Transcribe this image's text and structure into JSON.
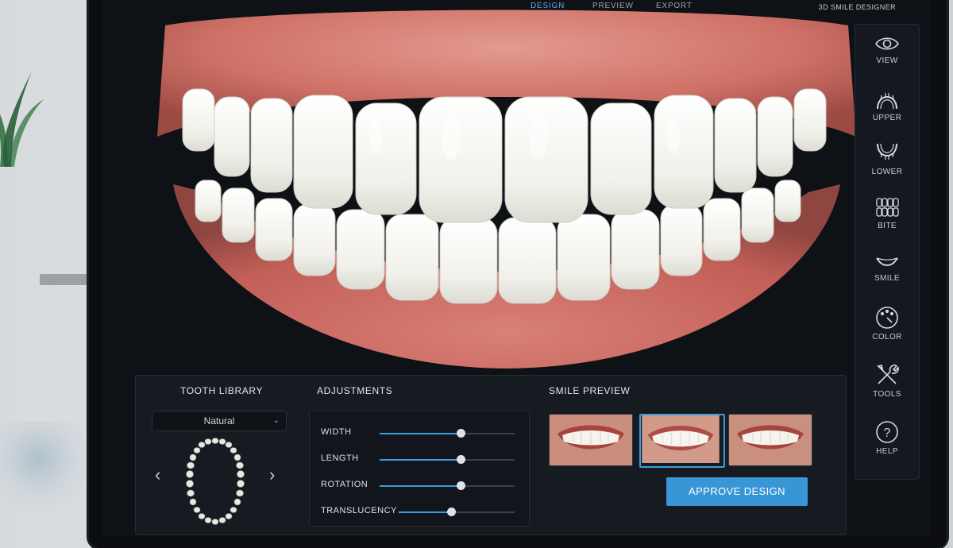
{
  "nav": {
    "items": [
      "DESIGN",
      "PREVIEW",
      "EXPORT"
    ],
    "active": "DESIGN",
    "brand": "3D SMILE DESIGNER"
  },
  "toolbar": {
    "items": [
      {
        "label": "VIEW",
        "icon": "eye-icon"
      },
      {
        "label": "UPPER",
        "icon": "upper-arch-icon"
      },
      {
        "label": "LOWER",
        "icon": "lower-arch-icon"
      },
      {
        "label": "BITE",
        "icon": "bite-icon"
      },
      {
        "label": "SMILE",
        "icon": "smile-icon"
      },
      {
        "label": "COLOR",
        "icon": "palette-icon"
      },
      {
        "label": "TOOLS",
        "icon": "tools-icon"
      },
      {
        "label": "HELP",
        "icon": "help-icon"
      }
    ]
  },
  "library": {
    "title": "TOOTH LIBRARY",
    "selected": "Natural",
    "prev_icon": "chevron-left-icon",
    "next_icon": "chevron-right-icon"
  },
  "adjustments": {
    "title": "ADJUSTMENTS",
    "sliders": [
      {
        "label": "WIDTH",
        "value": 0.6
      },
      {
        "label": "LENGTH",
        "value": 0.6
      },
      {
        "label": "ROTATION",
        "value": 0.6
      },
      {
        "label": "TRANSLUCENCY",
        "value": 0.45
      }
    ]
  },
  "preview": {
    "title": "SMILE PREVIEW",
    "thumbnails": 3,
    "selected_index": 1
  },
  "approve_label": "APPROVE DESIGN",
  "colors": {
    "accent": "#3c9be0",
    "panel": "#161a21",
    "gum": "#c8665f",
    "tooth": "#f2f1ec"
  }
}
